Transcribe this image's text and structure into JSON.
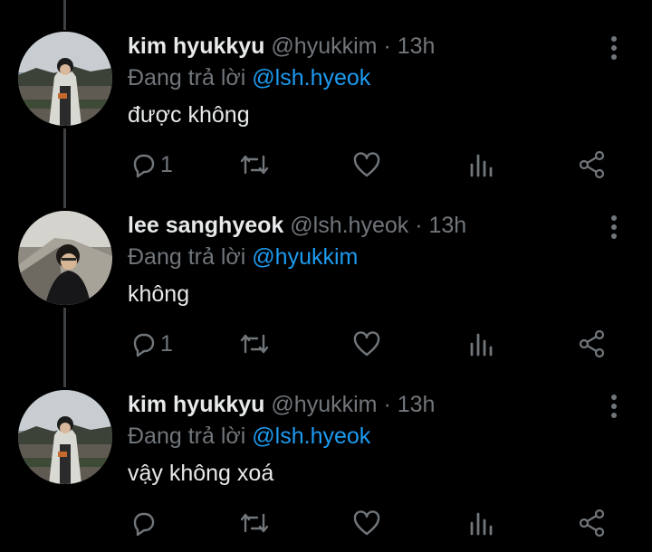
{
  "tweets": [
    {
      "name": "kim hyukkyu",
      "handle": "@hyukkim",
      "separator": "·",
      "time": "13h",
      "reply_prefix": "Đang trả lời",
      "reply_to": "@lsh.hyeok",
      "text": "được không",
      "reply_count": "1",
      "avatar_icon": "avatar-photo"
    },
    {
      "name": "lee sanghyeok",
      "handle": "@lsh.hyeok",
      "separator": "·",
      "time": "13h",
      "reply_prefix": "Đang trả lời",
      "reply_to": "@hyukkim",
      "text": "không",
      "reply_count": "1",
      "avatar_icon": "avatar-photo"
    },
    {
      "name": "kim hyukkyu",
      "handle": "@hyukkim",
      "separator": "·",
      "time": "13h",
      "reply_prefix": "Đang trả lời",
      "reply_to": "@lsh.hyeok",
      "text": "vậy không xoá",
      "reply_count": "",
      "avatar_icon": "avatar-photo"
    }
  ],
  "action_icons": [
    "reply-icon",
    "retweet-icon",
    "like-icon",
    "views-icon",
    "share-icon"
  ],
  "colors": {
    "background": "#000000",
    "text": "#e7e9ea",
    "muted": "#71767b",
    "link": "#1d9bf0",
    "thread_line": "#3e4144"
  }
}
